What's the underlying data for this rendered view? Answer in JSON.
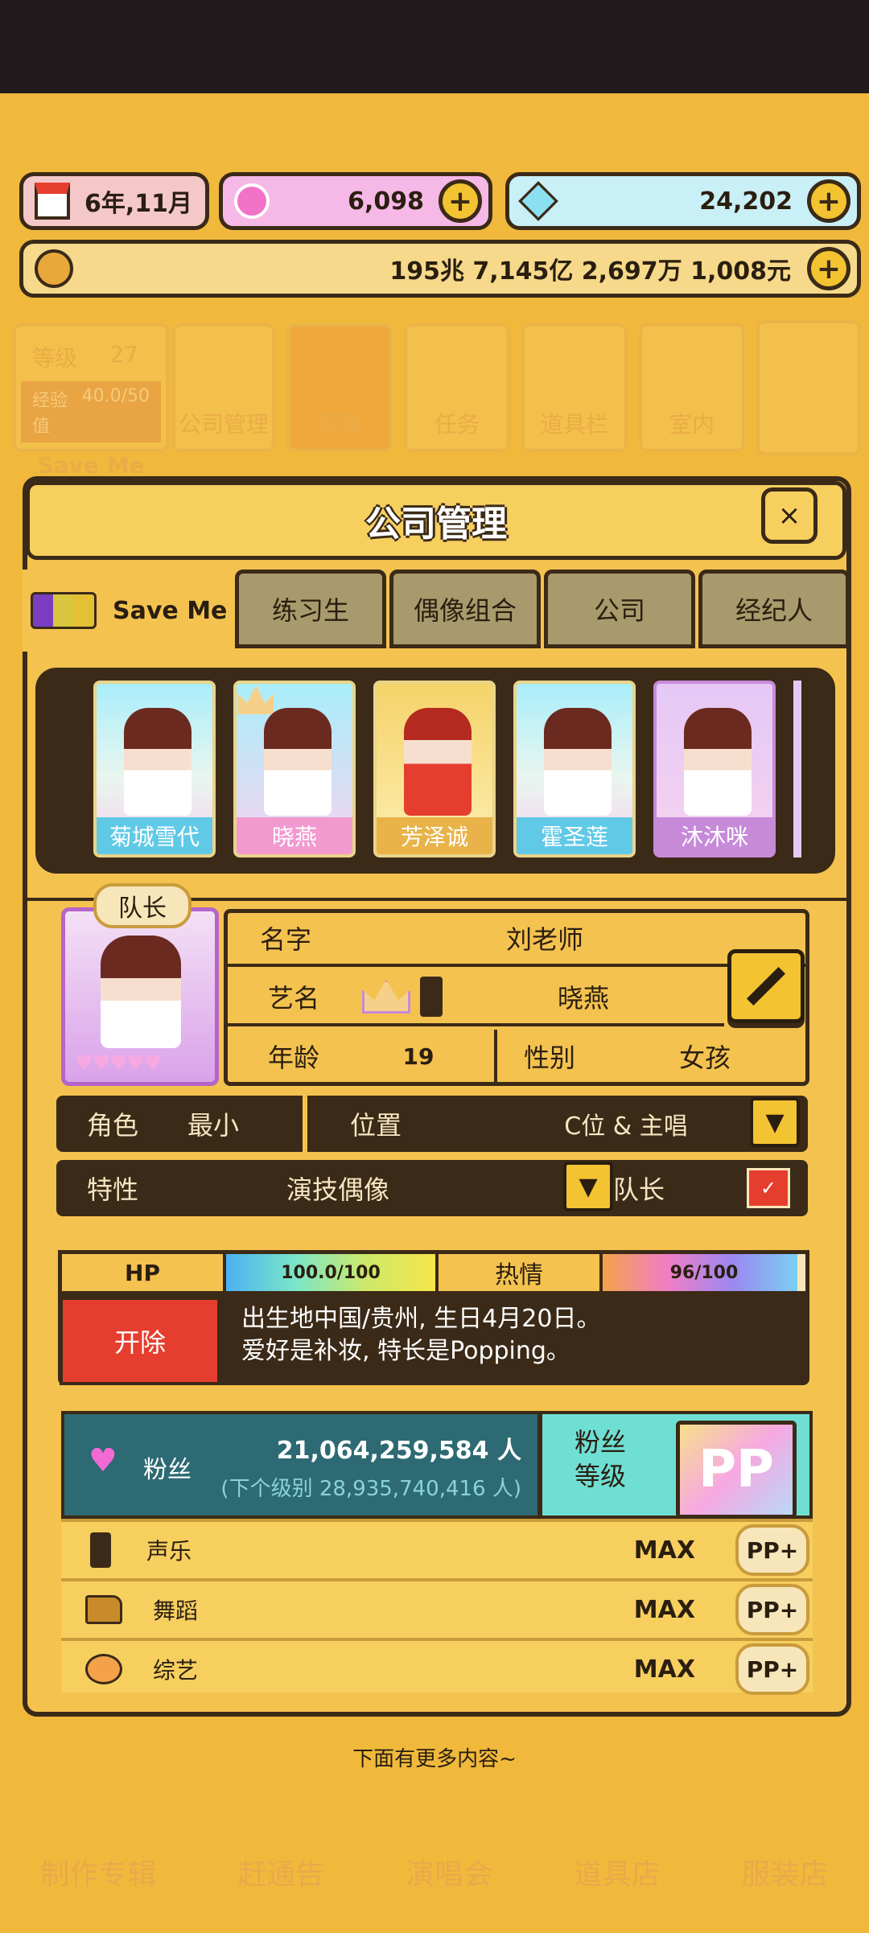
{
  "status": {
    "date": "6年,11月",
    "gems": "6,098",
    "diamonds": "24,202",
    "money": "195兆 7,145亿 2,697万 1,008元"
  },
  "background_menu": {
    "level_label": "等级",
    "level_value": "27",
    "exp_label": "经验值",
    "exp_value": "40.0/50",
    "group_name": "Save Me",
    "tiles": [
      "公司管理",
      "招募",
      "任务",
      "道具栏",
      "室内"
    ],
    "bottom": [
      "制作专辑",
      "赶通告",
      "演唱会",
      "道具店",
      "服装店"
    ]
  },
  "dialog": {
    "title": "公司管理",
    "close": "×",
    "tabs": [
      "Save Me",
      "练习生",
      "偶像组合",
      "公司",
      "经纪人"
    ],
    "members": [
      "菊城雪代",
      "晓燕",
      "芳泽诚",
      "霍圣莲",
      "沐沐咪"
    ],
    "leader_badge": "队长",
    "profile": {
      "name_label": "名字",
      "name": "刘老师",
      "stage_label": "艺名",
      "stage_name": "晓燕",
      "age_label": "年龄",
      "age": "19",
      "gender_label": "性别",
      "gender": "女孩"
    },
    "role_label": "角色",
    "role": "最小",
    "position_label": "位置",
    "position": "C位 & 主唱",
    "trait_label": "特性",
    "trait": "演技偶像",
    "leader_label": "队长",
    "hp_label": "HP",
    "hp": "100.0/100",
    "hp_fraction": 1.0,
    "passion_label": "热情",
    "passion": "96/100",
    "passion_fraction": 0.96,
    "fire_button": "开除",
    "bio_line1": "出生地中国/贵州, 生日4月20日。",
    "bio_line2": "爱好是补妆, 特长是Popping。",
    "fans_label": "粉丝",
    "fans_count": "21,064,259,584 人",
    "fans_next": "(下个级别 28,935,740,416 人)",
    "fan_level_label_1": "粉丝",
    "fan_level_label_2": "等级",
    "stats": [
      {
        "name": "声乐",
        "value": "MAX",
        "button": "PP+",
        "icon": "microphone-icon"
      },
      {
        "name": "舞蹈",
        "value": "MAX",
        "button": "PP+",
        "icon": "shoe-icon"
      },
      {
        "name": "综艺",
        "value": "MAX",
        "button": "PP+",
        "icon": "envelope-icon"
      }
    ],
    "more_hint": "下面有更多内容~"
  },
  "colors": {
    "background": "#f0b93c",
    "panel": "#f4c24f",
    "outline": "#3b2a17",
    "fire": "#e53e2f",
    "fans": "#2d6a73",
    "teal": "#6fdfd4"
  }
}
